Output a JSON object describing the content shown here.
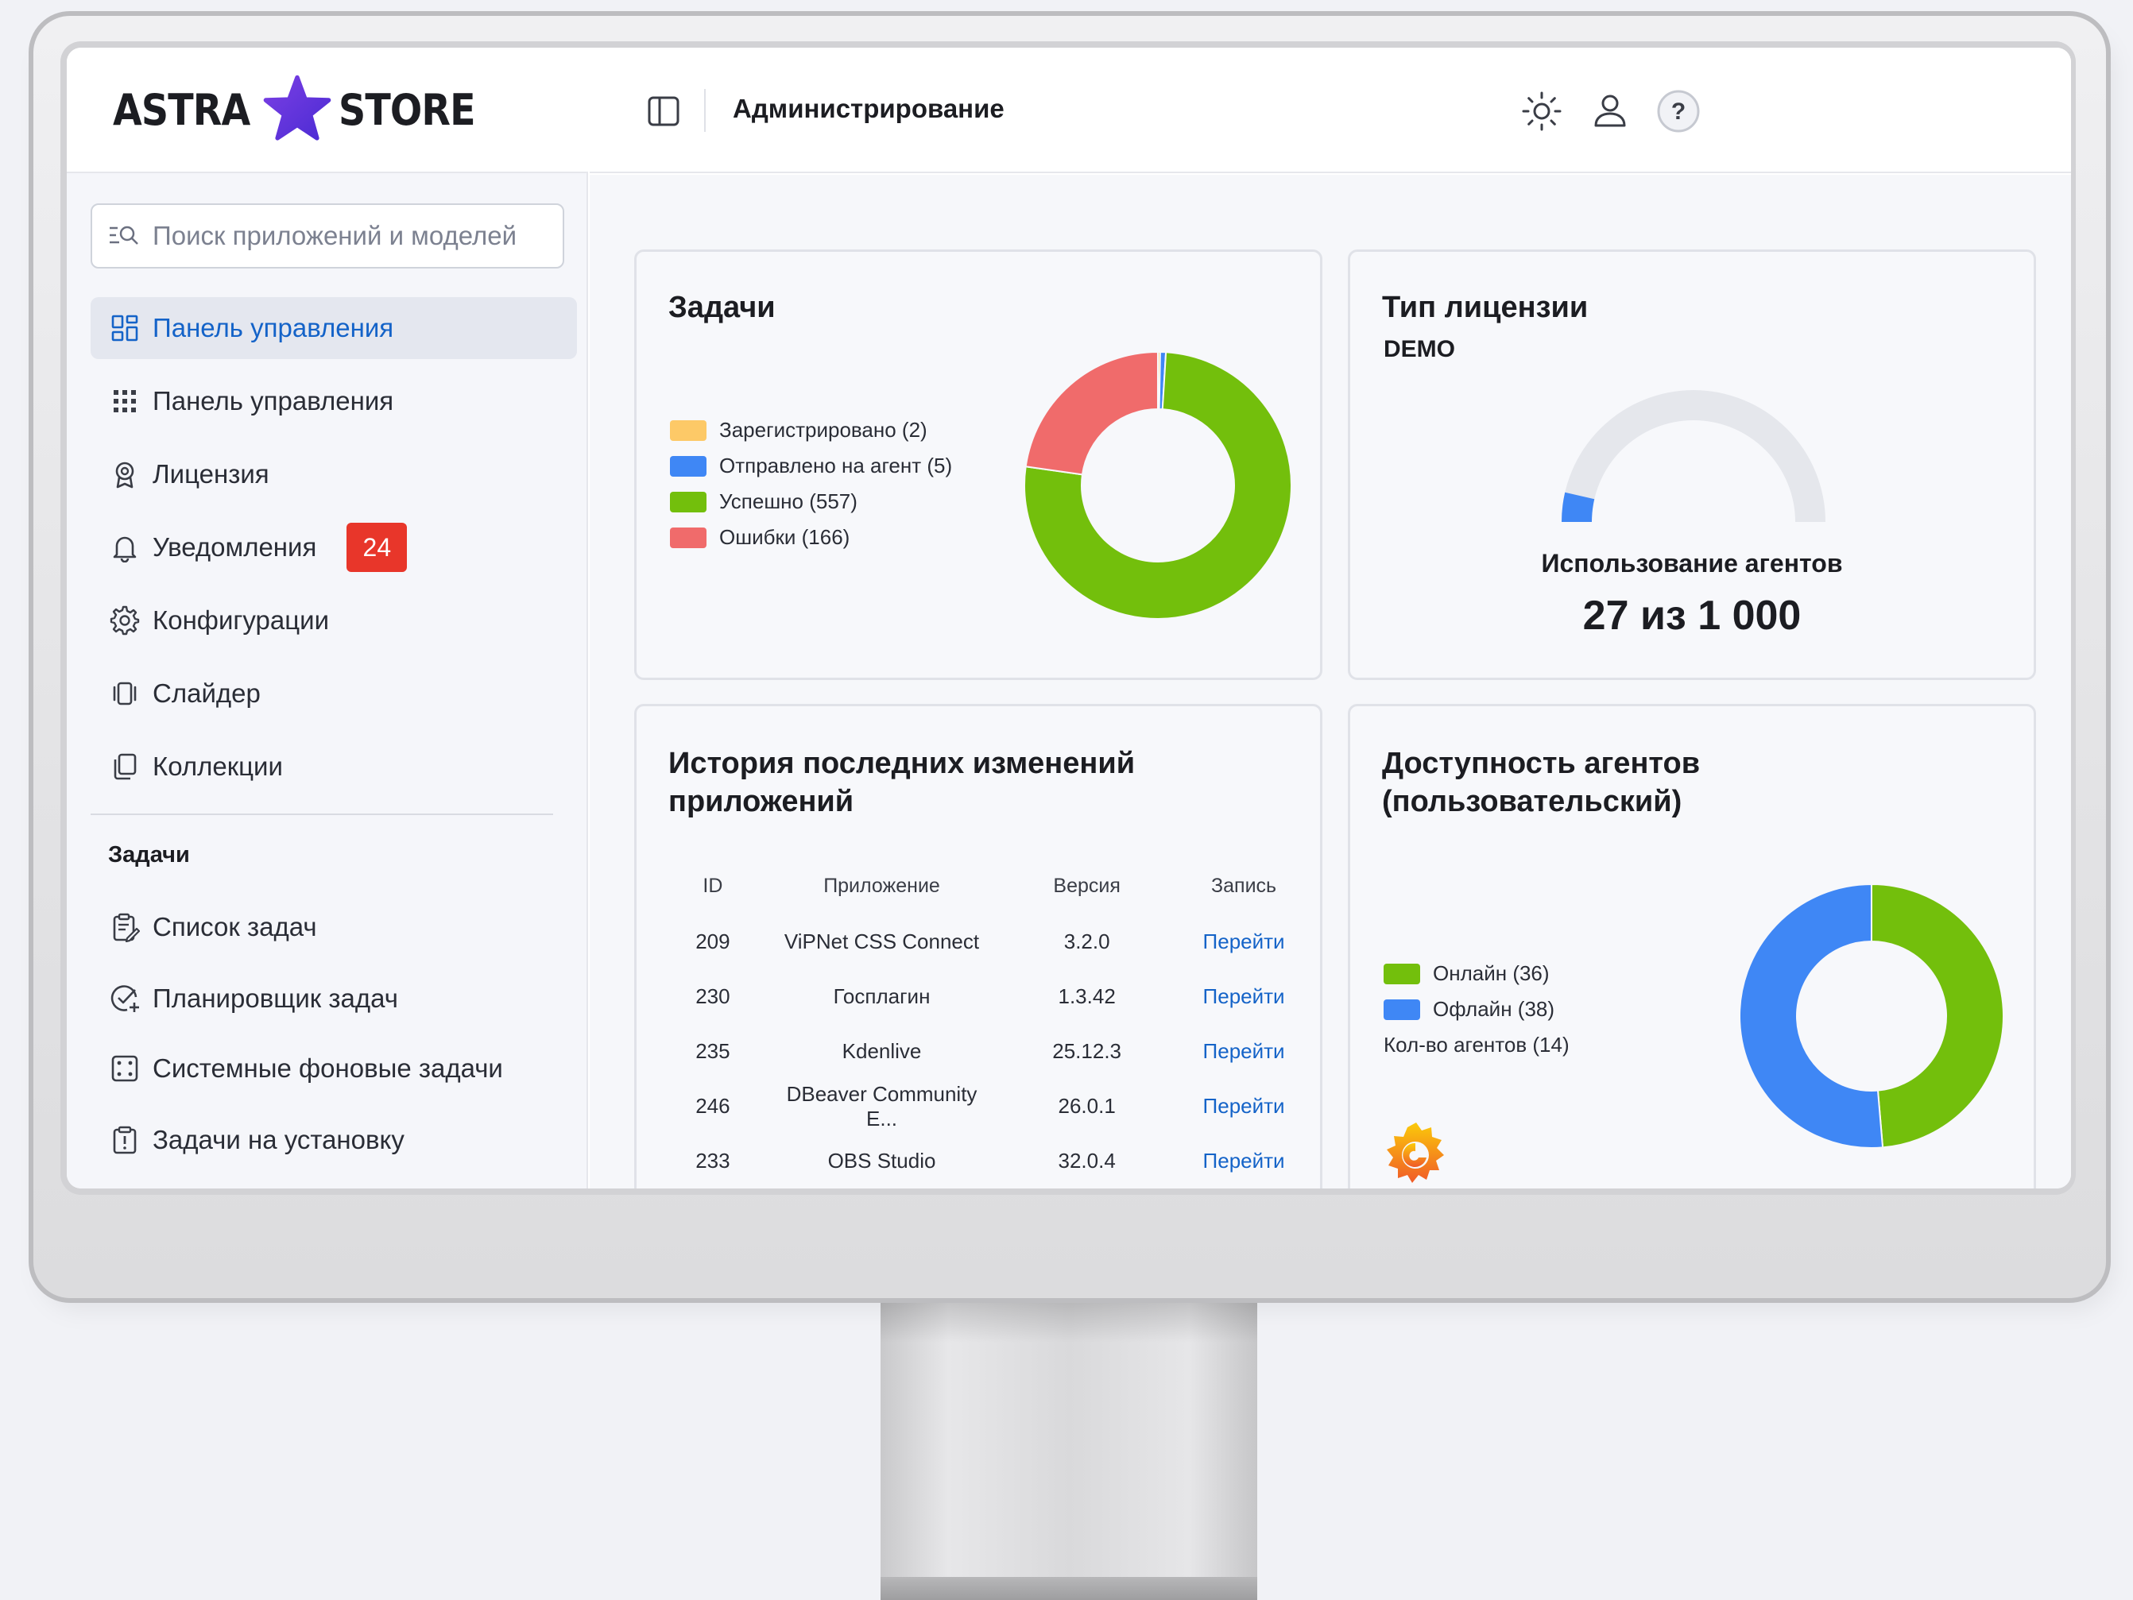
{
  "app": {
    "logo_left": "ASTRA",
    "logo_right": "STORE",
    "page_title": "Администрирование"
  },
  "search": {
    "placeholder": "Поиск приложений и моделей"
  },
  "sidebar": {
    "items": [
      {
        "label": "Панель управления",
        "icon": "dashboard-grid-icon",
        "active": true
      },
      {
        "label": "Панель управления",
        "icon": "dots-grid-icon"
      },
      {
        "label": "Лицензия",
        "icon": "award-icon"
      },
      {
        "label": "Уведомления",
        "icon": "bell-icon",
        "badge": "24"
      },
      {
        "label": "Конфигурации",
        "icon": "gear-icon"
      },
      {
        "label": "Слайдер",
        "icon": "slider-icon"
      },
      {
        "label": "Коллекции",
        "icon": "collections-icon"
      }
    ],
    "section_title": "Задачи",
    "task_items": [
      {
        "label": "Список задач",
        "icon": "clipboard-edit-icon"
      },
      {
        "label": "Планировщик задач",
        "icon": "check-circle-plus-icon"
      },
      {
        "label": "Системные фоновые задачи",
        "icon": "dice-icon"
      },
      {
        "label": "Задачи на установку",
        "icon": "clipboard-alert-icon"
      }
    ]
  },
  "cards": {
    "tasks": {
      "title": "Задачи",
      "legend": [
        {
          "label": "Зарегистрировано (2)",
          "color": "#fdc967"
        },
        {
          "label": "Отправлено на агент (5)",
          "color": "#3f87f5"
        },
        {
          "label": "Успешно (557)",
          "color": "#73bf0c"
        },
        {
          "label": "Ошибки (166)",
          "color": "#f06b6b"
        }
      ]
    },
    "license": {
      "title": "Тип лицензии",
      "type": "DEMO",
      "usage_label": "Использование агентов",
      "usage_value": "27 из 1 000"
    },
    "history": {
      "title": "История последних изменений приложений",
      "columns": [
        "ID",
        "Приложение",
        "Версия",
        "Запись"
      ],
      "rows": [
        {
          "id": "209",
          "app": "ViPNet CSS Connect",
          "version": "3.2.0",
          "link": "Перейти"
        },
        {
          "id": "230",
          "app": "Госплагин",
          "version": "1.3.42",
          "link": "Перейти"
        },
        {
          "id": "235",
          "app": "Kdenlive",
          "version": "25.12.3",
          "link": "Перейти"
        },
        {
          "id": "246",
          "app": "DBeaver Community E...",
          "version": "26.0.1",
          "link": "Перейти"
        },
        {
          "id": "233",
          "app": "OBS Studio",
          "version": "32.0.4",
          "link": "Перейти"
        }
      ]
    },
    "availability": {
      "title": "Доступность агентов (пользовательский)",
      "legend": [
        {
          "label": "Онлайн (36)",
          "color": "#73bf0c"
        },
        {
          "label": "Офлайн (38)",
          "color": "#3f87f5"
        }
      ],
      "count_label": "Кол-во агентов (14)"
    }
  },
  "chart_data": [
    {
      "type": "pie",
      "donut": true,
      "categories": [
        "Зарегистрировано",
        "Отправлено на агент",
        "Успешно",
        "Ошибки"
      ],
      "values": [
        2,
        5,
        557,
        166
      ],
      "colors": [
        "#fdc967",
        "#3f87f5",
        "#73bf0c",
        "#f06b6b"
      ]
    },
    {
      "type": "gauge",
      "value": 27,
      "max": 1000,
      "colors": [
        "#3f87f5",
        "#e5e7ec"
      ]
    },
    {
      "type": "pie",
      "donut": true,
      "categories": [
        "Онлайн",
        "Офлайн"
      ],
      "values": [
        36,
        38
      ],
      "colors": [
        "#73bf0c",
        "#3f87f5"
      ]
    }
  ]
}
